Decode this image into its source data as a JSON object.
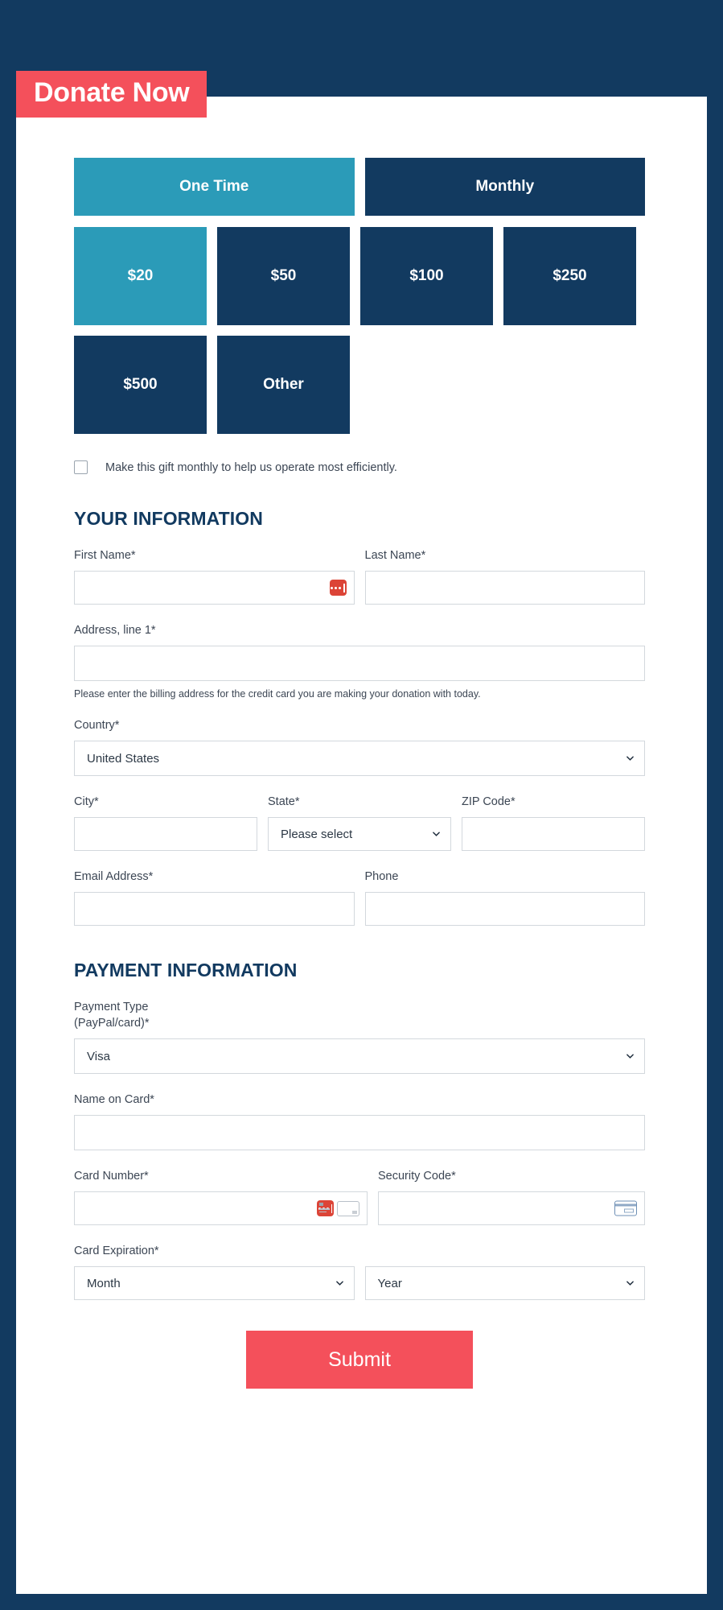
{
  "banner": {
    "title": "Donate Now"
  },
  "colors": {
    "page_background": "#123A60",
    "card_background": "#ffffff",
    "accent_red": "#F4505B",
    "accent_teal": "#2B9BB8",
    "navy": "#123A60",
    "autofill_red": "#DC4437"
  },
  "frequency": {
    "options": [
      {
        "label": "One Time",
        "selected": true
      },
      {
        "label": "Monthly",
        "selected": false
      }
    ]
  },
  "amounts": {
    "options": [
      {
        "label": "$20",
        "selected": true
      },
      {
        "label": "$50",
        "selected": false
      },
      {
        "label": "$100",
        "selected": false
      },
      {
        "label": "$250",
        "selected": false
      },
      {
        "label": "$500",
        "selected": false
      },
      {
        "label": "Other",
        "selected": false
      }
    ]
  },
  "monthly_upsell": {
    "label": "Make this gift monthly to help us operate most efficiently.",
    "checked": false
  },
  "your_information": {
    "heading": "YOUR INFORMATION",
    "first_name": {
      "label": "First Name*",
      "value": "",
      "placeholder": ""
    },
    "last_name": {
      "label": "Last Name*",
      "value": "",
      "placeholder": ""
    },
    "address1": {
      "label": "Address, line 1*",
      "value": "",
      "placeholder": ""
    },
    "address_helper": "Please enter the billing address for the credit card you are making your donation with today.",
    "country": {
      "label": "Country*",
      "value": "United States"
    },
    "city": {
      "label": "City*",
      "value": "",
      "placeholder": ""
    },
    "state": {
      "label": "State*",
      "value": "Please select"
    },
    "zip": {
      "label": "ZIP Code*",
      "value": "",
      "placeholder": ""
    },
    "email": {
      "label": "Email Address*",
      "value": "",
      "placeholder": ""
    },
    "phone": {
      "label": "Phone",
      "value": "",
      "placeholder": ""
    }
  },
  "payment_information": {
    "heading": "PAYMENT INFORMATION",
    "payment_type": {
      "label_line1": "Payment Type",
      "label_line2": "(PayPal/card)*",
      "value": "Visa"
    },
    "name_on_card": {
      "label": "Name on Card*",
      "value": "",
      "placeholder": ""
    },
    "card_number": {
      "label": "Card Number*",
      "value": "",
      "placeholder": ""
    },
    "security_code": {
      "label": "Security Code*",
      "value": "",
      "placeholder": ""
    },
    "card_expiration": {
      "label": "Card Expiration*",
      "month": "Month",
      "year": "Year"
    }
  },
  "submit": {
    "label": "Submit"
  }
}
